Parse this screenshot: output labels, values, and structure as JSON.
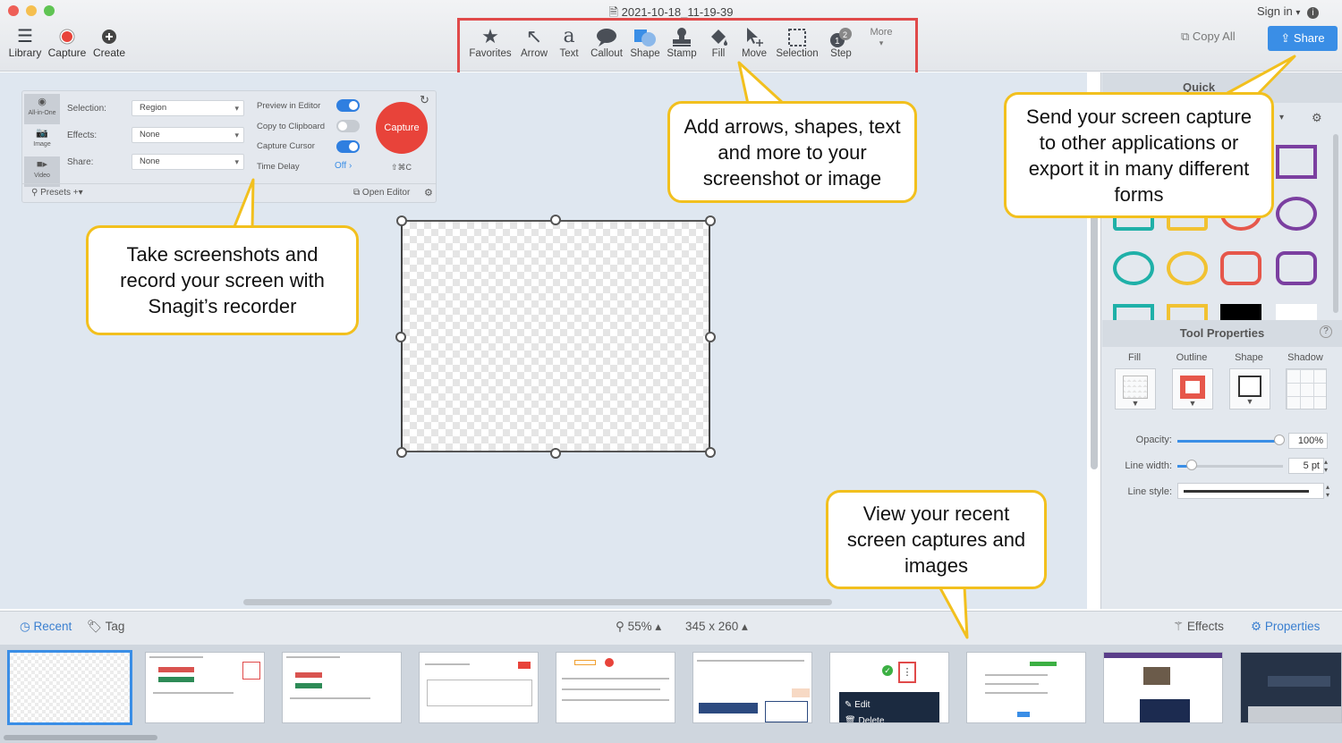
{
  "window": {
    "title": "2021-10-18_11-19-39"
  },
  "left_tools": [
    {
      "label": "Library",
      "icon": "hamburger-icon"
    },
    {
      "label": "Capture",
      "icon": "record-dot-icon"
    },
    {
      "label": "Create",
      "icon": "plus-circle-icon"
    }
  ],
  "tools": [
    {
      "label": "Favorites",
      "icon": "star-icon",
      "glyph": "★"
    },
    {
      "label": "Arrow",
      "icon": "arrow-icon",
      "glyph": "↖"
    },
    {
      "label": "Text",
      "icon": "text-icon",
      "glyph": "a"
    },
    {
      "label": "Callout",
      "icon": "callout-icon",
      "glyph": "💬"
    },
    {
      "label": "Shape",
      "icon": "shape-icon",
      "glyph": "◼"
    },
    {
      "label": "Stamp",
      "icon": "stamp-icon",
      "glyph": "⊥"
    },
    {
      "label": "Fill",
      "icon": "fill-bucket-icon",
      "glyph": "◆"
    },
    {
      "label": "Move",
      "icon": "move-icon",
      "glyph": "➤"
    },
    {
      "label": "Selection",
      "icon": "selection-icon",
      "glyph": "⬚"
    },
    {
      "label": "Step",
      "icon": "step-icon",
      "glyph": "③"
    }
  ],
  "more_label": "More",
  "header_right": {
    "sign_in": "Sign in",
    "copy_all": "Copy All",
    "share": "Share"
  },
  "capture_panel": {
    "modes": [
      "All-in-One",
      "Image",
      "Video"
    ],
    "selection_label": "Selection:",
    "selection_value": "Region",
    "effects_label": "Effects:",
    "effects_value": "None",
    "share_label": "Share:",
    "share_value": "None",
    "preview_label": "Preview in Editor",
    "clipboard_label": "Copy to Clipboard",
    "cursor_label": "Capture Cursor",
    "delay_label": "Time Delay",
    "delay_value": "Off",
    "capture_button": "Capture",
    "shortcut": "⇧⌘C",
    "presets": "Presets",
    "open_editor": "Open Editor"
  },
  "quick_styles_label": "Quick",
  "tool_properties": {
    "title": "Tool Properties",
    "columns": [
      "Fill",
      "Outline",
      "Shape",
      "Shadow"
    ],
    "opacity_label": "Opacity:",
    "opacity_value": "100%",
    "opacity_level": 1.0,
    "line_width_label": "Line width:",
    "line_width_value": "5 pt",
    "line_style_label": "Line style:"
  },
  "bottom_bar": {
    "recent": "Recent",
    "tag": "Tag",
    "zoom": "55% ▴",
    "dimensions": "345 x 260 ▴",
    "effects": "Effects",
    "properties": "Properties"
  },
  "thumbnail_texts": {
    "edit": "Edit",
    "delete": "Delete"
  },
  "callouts": {
    "tools": "Add arrows, shapes, text and more to your screenshot or image",
    "share": "Send your screen capture to other applications or export it in many different forms",
    "capture": "Take screenshots and record your screen with Snagit’s recorder",
    "recent": "View your recent screen captures and images"
  },
  "colors": {
    "accent": "#3a8ee6",
    "capture_red": "#e8433a",
    "callout_border": "#f2c01e",
    "highlight_red": "#e04a4a"
  }
}
